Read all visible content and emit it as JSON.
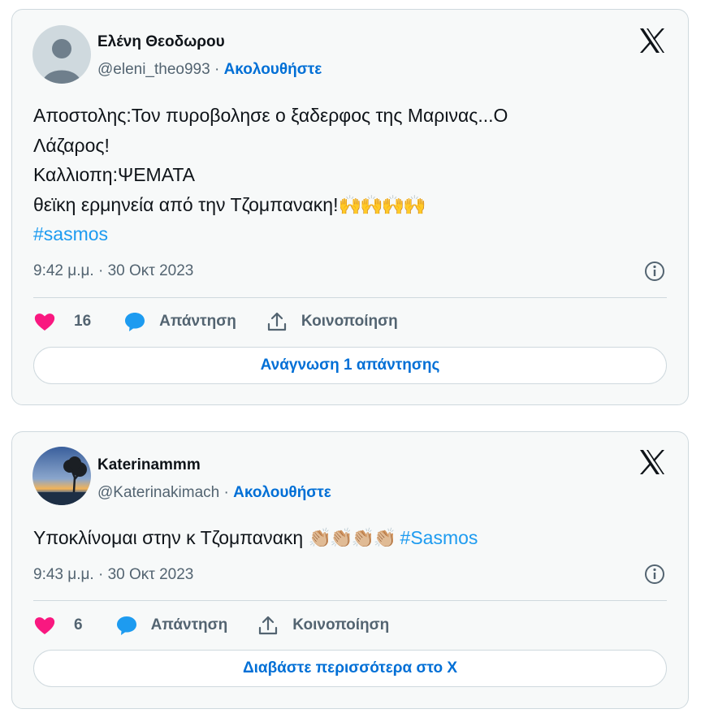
{
  "tweets": [
    {
      "author_name": "Ελένη Θεοδωρου",
      "handle": "@eleni_theo993",
      "separator": "·",
      "follow_label": "Ακολουθήστε",
      "text_lines": [
        "Αποστολης:Τον πυροβολησε ο ξαδερφος της Μαρινας...Ο",
        "Λάζαρος!",
        "Καλλιοπη:ΨΕΜΑΤΑ",
        "θεϊκη ερμηνεία από την Τζομπανακη!"
      ],
      "emoji": "🙌🙌🙌🙌",
      "hashtag": "#sasmos",
      "timestamp": "9:42 μ.μ. · 30 Οκτ 2023",
      "like_count": "16",
      "reply_label": "Απάντηση",
      "share_label": "Κοινοποίηση",
      "read_button_label": "Ανάγνωση 1 απάντησης"
    },
    {
      "author_name": "Katerinammm",
      "handle": "@Katerinakimach",
      "separator": "·",
      "follow_label": "Ακολουθήστε",
      "text": "Υποκλίνομαι στην κ Τζομπανακη",
      "emoji": "👏🏼👏🏼👏🏼👏🏼",
      "hashtag": "#Sasmos",
      "timestamp": "9:43 μ.μ. · 30 Οκτ 2023",
      "like_count": "6",
      "reply_label": "Απάντηση",
      "share_label": "Κοινοποίηση",
      "read_button_label": "Διαβάστε περισσότερα στο X"
    }
  ],
  "icons": {
    "close_logo": "x-logo-icon",
    "like": "heart-icon",
    "reply": "speech-bubble-icon",
    "share": "share-upload-icon",
    "info": "info-icon"
  },
  "colors": {
    "like": "#f91880",
    "reply": "#1d9bf0",
    "link": "#006fd6",
    "hashtag": "#1d9bf0",
    "muted": "#536471"
  }
}
